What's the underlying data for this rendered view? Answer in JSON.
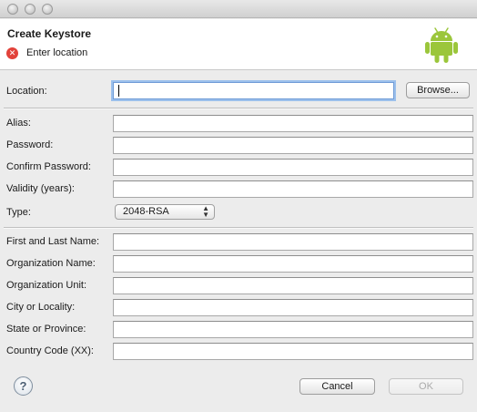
{
  "window": {
    "traffic_lights": [
      "close",
      "minimize",
      "zoom"
    ]
  },
  "banner": {
    "title": "Create Keystore",
    "message": "Enter location",
    "status_icon": "error-icon",
    "logo_icon": "android-icon",
    "logo_color": "#9bc63b"
  },
  "location": {
    "label": "Location:",
    "value": "",
    "browse_label": "Browse..."
  },
  "keystore": {
    "alias_label": "Alias:",
    "password_label": "Password:",
    "confirm_label": "Confirm Password:",
    "validity_label": "Validity (years):",
    "type_label": "Type:",
    "type_value": "2048-RSA"
  },
  "identity": {
    "name_label": "First and Last Name:",
    "org_label": "Organization Name:",
    "unit_label": "Organization Unit:",
    "city_label": "City or Locality:",
    "state_label": "State or Province:",
    "country_label": "Country Code (XX):"
  },
  "footer": {
    "help_icon": "help-icon",
    "cancel_label": "Cancel",
    "ok_label": "OK"
  }
}
